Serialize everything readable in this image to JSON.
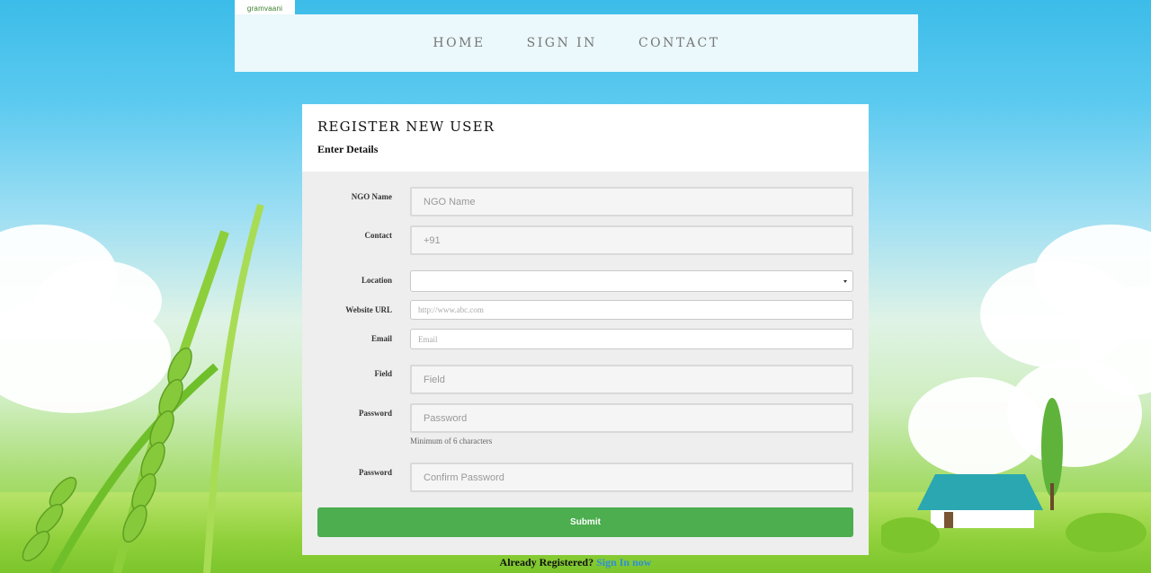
{
  "logo": {
    "text": "gramvaani"
  },
  "nav": {
    "items": [
      "HOME",
      "SIGN IN",
      "CONTACT"
    ]
  },
  "form": {
    "title": "REGISTER NEW USER",
    "subtitle": "Enter Details",
    "fields": {
      "ngo_name": {
        "label": "NGO Name",
        "placeholder": "NGO Name"
      },
      "contact": {
        "label": "Contact",
        "value": "+91"
      },
      "location": {
        "label": "Location",
        "value": ""
      },
      "website": {
        "label": "Website URL",
        "placeholder": "http://www.abc.com"
      },
      "email": {
        "label": "Email",
        "placeholder": "Email"
      },
      "field": {
        "label": "Field",
        "placeholder": "Field"
      },
      "password": {
        "label": "Password",
        "placeholder": "Password",
        "help": "Minimum of 6 characters"
      },
      "confirm_password": {
        "label": "Password",
        "placeholder": "Confirm Password"
      }
    },
    "submit_label": "Submit"
  },
  "footer": {
    "text": "Already Registered?",
    "link": "Sign In now"
  },
  "colors": {
    "accent": "#4cae4f",
    "link": "#2f8fd6",
    "nav_bg": "#ebf8fc"
  }
}
